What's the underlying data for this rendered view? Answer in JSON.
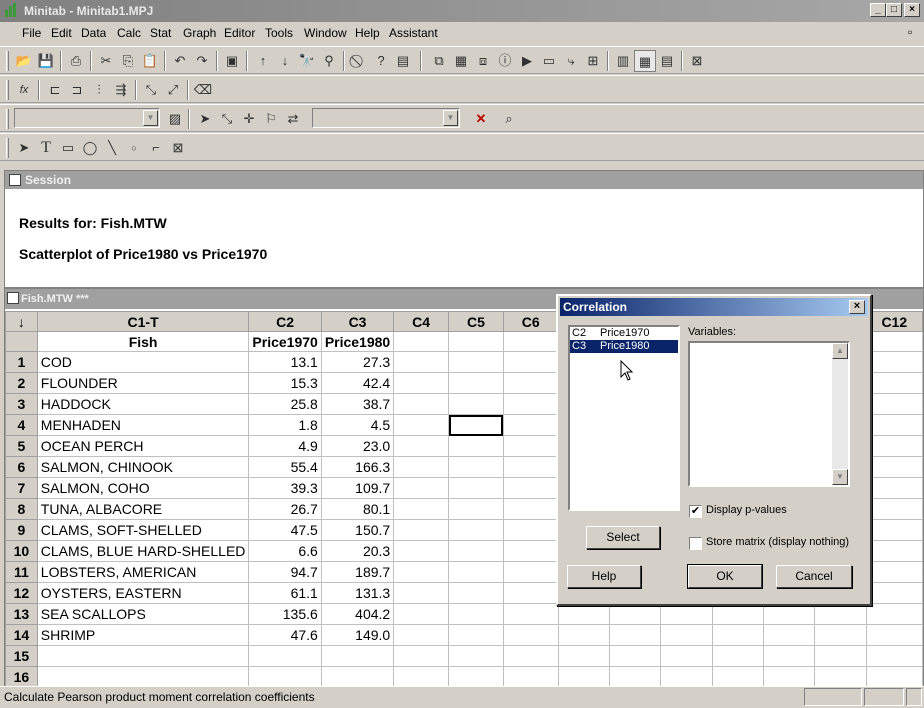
{
  "window": {
    "title": "Minitab - Minitab1.MPJ"
  },
  "menu": [
    "File",
    "Edit",
    "Data",
    "Calc",
    "Stat",
    "Graph",
    "Editor",
    "Tools",
    "Window",
    "Help",
    "Assistant"
  ],
  "session": {
    "title": "Session",
    "line1": "Results for: Fish.MTW",
    "line2": "Scatterplot of Price1980 vs Price1970"
  },
  "worksheet": {
    "title": "Fish.MTW ***",
    "corner": "↓",
    "columns": [
      "C1-T",
      "C2",
      "C3",
      "C4",
      "C5",
      "C6",
      "C12"
    ],
    "names": [
      "Fish",
      "Price1970",
      "Price1980"
    ],
    "rows": [
      [
        "COD",
        "13.1",
        "27.3"
      ],
      [
        "FLOUNDER",
        "15.3",
        "42.4"
      ],
      [
        "HADDOCK",
        "25.8",
        "38.7"
      ],
      [
        "MENHADEN",
        "1.8",
        "4.5"
      ],
      [
        "OCEAN PERCH",
        "4.9",
        "23.0"
      ],
      [
        "SALMON, CHINOOK",
        "55.4",
        "166.3"
      ],
      [
        "SALMON, COHO",
        "39.3",
        "109.7"
      ],
      [
        "TUNA, ALBACORE",
        "26.7",
        "80.1"
      ],
      [
        "CLAMS, SOFT-SHELLED",
        "47.5",
        "150.7"
      ],
      [
        "CLAMS, BLUE HARD-SHELLED",
        "6.6",
        "20.3"
      ],
      [
        "LOBSTERS, AMERICAN",
        "94.7",
        "189.7"
      ],
      [
        "OYSTERS, EASTERN",
        "61.1",
        "131.3"
      ],
      [
        "SEA SCALLOPS",
        "135.6",
        "404.2"
      ],
      [
        "SHRIMP",
        "47.6",
        "149.0"
      ],
      [
        "",
        "",
        ""
      ],
      [
        "",
        "",
        ""
      ]
    ],
    "row_numbers": [
      "1",
      "2",
      "3",
      "4",
      "5",
      "6",
      "7",
      "8",
      "9",
      "10",
      "11",
      "12",
      "13",
      "14",
      "15",
      "16"
    ]
  },
  "dialog": {
    "title": "Correlation",
    "close": "×",
    "list": [
      {
        "id": "C2",
        "name": "Price1970",
        "selected": false
      },
      {
        "id": "C3",
        "name": "Price1980",
        "selected": true
      }
    ],
    "variables_label": "Variables:",
    "variables_value": "",
    "display_pvalues": {
      "label": "Display p-values",
      "checked": true
    },
    "store_matrix": {
      "label": "Store matrix (display nothing)",
      "checked": false
    },
    "select_button": "Select",
    "help_button": "Help",
    "ok_button": "OK",
    "cancel_button": "Cancel"
  },
  "status": {
    "text": "Calculate Pearson product moment correlation coefficients"
  }
}
